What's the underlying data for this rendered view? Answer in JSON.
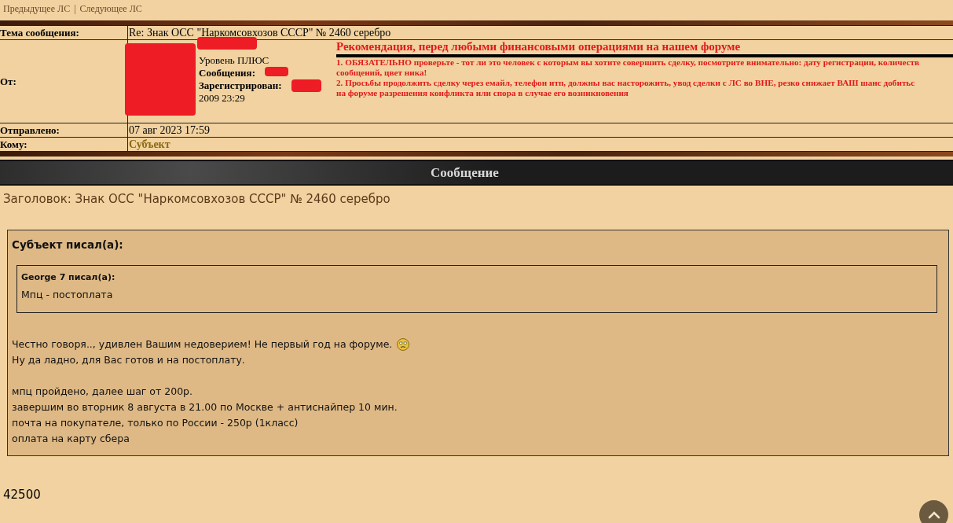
{
  "nav": {
    "links": [
      "Предыдущее ЛС",
      "Следующее ЛС"
    ],
    "separator": "|"
  },
  "header": {
    "subject": {
      "label": "Тема сообщения:",
      "value": "Re: Знак ОСС \"Наркомсовхозов СССР\" № 2460 серебро"
    },
    "from": {
      "label": "От:",
      "level": "Уровень ПЛЮС",
      "messages_label": "Сообщения:",
      "registered_label": "Зарегистрирован:",
      "registered_time": "2009 23:29",
      "notice": {
        "title": "Рекомендация, перед любыми финансовыми операциями на нашем форуме",
        "lines": [
          "1. ОБЯЗАТЕЛЬНО проверьте - тот ли это человек с которым вы хотите совершить сделку, посмотрите внимательно: дату регистрации, количеств",
          "сообщений, цвет ника!",
          "2. Просьбы продолжить сделку через емайл, телефон итп, должны вас насторожить, увод сделки с ЛС во ВНЕ, резко снижает ВАШ шанс добитьс",
          "на форуме разрешения конфликта или спора в случае его возникновения"
        ]
      }
    },
    "sent": {
      "label": "Отправлено:",
      "value": "07 авг 2023 17:59"
    },
    "to": {
      "label": "Кому:",
      "value": "Субъект"
    }
  },
  "banner": {
    "title": "Сообщение"
  },
  "heading": "Заголовок: Знак ОСС \"Наркомсовхозов СССР\" № 2460 серебро",
  "quote": {
    "author": "Субъект писал(а):",
    "inner_quote": {
      "author": "George 7 писал(а):",
      "text": "Мпц - постоплата"
    },
    "paragraphs": [
      [
        "Честно говоря.., удивлен Вашим недоверием! Не первый год на форуме.",
        "Ну да ладно, для Вас готов и на постоплату."
      ],
      [
        "мпц пройдено, далее шаг от 200р.",
        "завершим во вторник 8 августа в 21.00 по Москве + антиснайпер 10 мин.",
        "почта на покупателе, только по России - 250р (1класс)",
        "оплата на карту сбера"
      ]
    ]
  },
  "footer_text": "42500"
}
